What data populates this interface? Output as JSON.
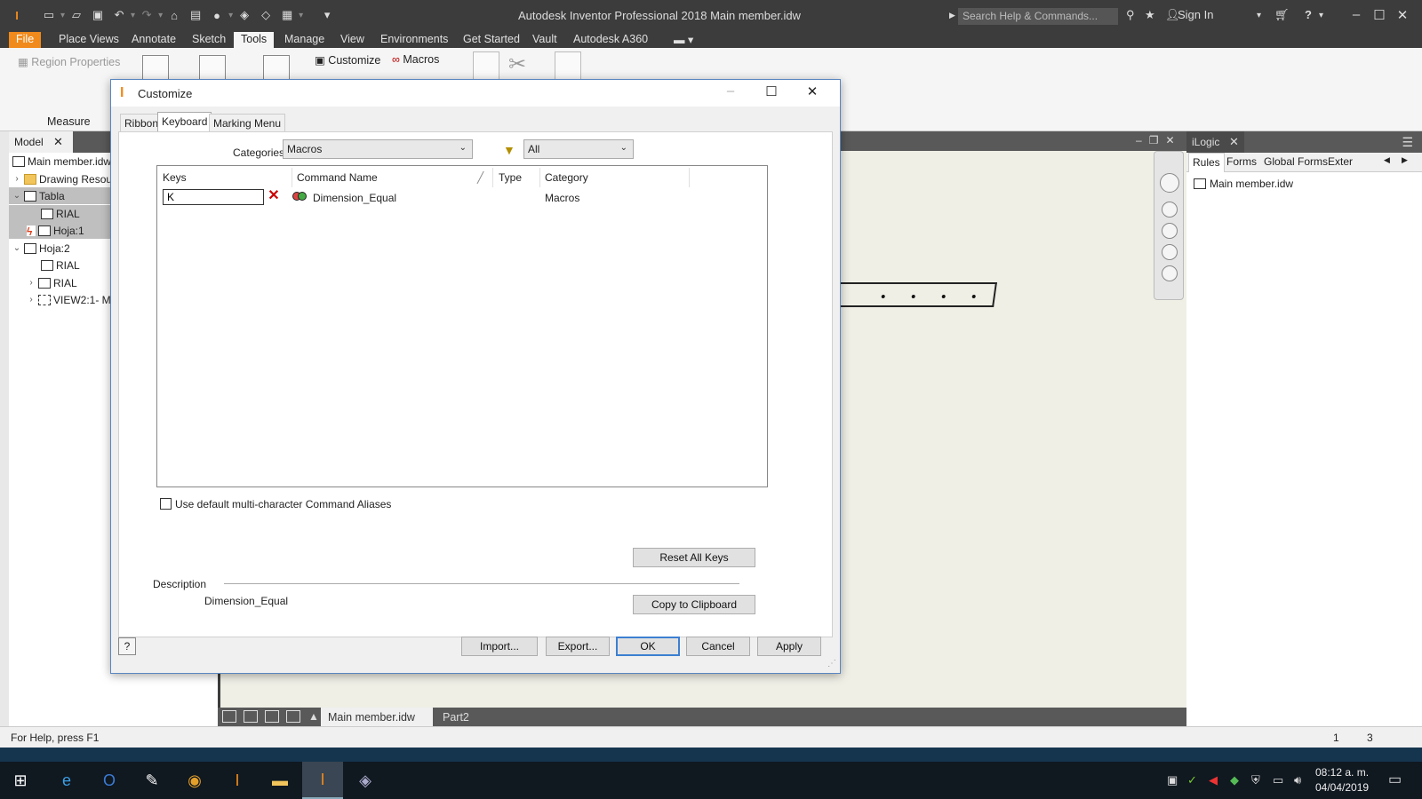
{
  "app": {
    "title": "Autodesk Inventor Professional 2018    Main member.idw",
    "search_placeholder": "Search Help & Commands...",
    "sign_in": "Sign In"
  },
  "ribbon": {
    "tabs": [
      "File",
      "Place Views",
      "Annotate",
      "Sketch",
      "Tools",
      "Manage",
      "View",
      "Environments",
      "Get Started",
      "Vault",
      "Autodesk A360"
    ],
    "active_tab": "Tools",
    "region_properties": "Region Properties",
    "measure_label": "Measure",
    "customize_label": "Customize",
    "macros_label": "Macros"
  },
  "browser": {
    "tab_label": "Model",
    "items": [
      {
        "label": "Main member.idw"
      },
      {
        "label": "Drawing Resour"
      },
      {
        "label": "Tabla"
      },
      {
        "label": "RIAL"
      },
      {
        "label": "Hoja:1"
      },
      {
        "label": "Hoja:2"
      },
      {
        "label": "RIAL"
      },
      {
        "label": "RIAL"
      },
      {
        "label": "VIEW2:1- Ma"
      }
    ]
  },
  "ilogic": {
    "title": "iLogic",
    "tabs": [
      "Rules",
      "Forms",
      "Global Forms",
      "Exter"
    ],
    "active_tab": "Rules",
    "tree_item": "Main member.idw"
  },
  "doc_tabs": [
    {
      "label": "Main member.idw",
      "active": true
    },
    {
      "label": "Part2",
      "active": false
    }
  ],
  "status": {
    "help": "For Help, press F1",
    "count_a": "1",
    "count_b": "3"
  },
  "clock": {
    "time": "08:12 a. m.",
    "date": "04/04/2019"
  },
  "dialog": {
    "title": "Customize",
    "tabs": [
      "Ribbon",
      "Keyboard",
      "Marking Menu"
    ],
    "active_tab": "Keyboard",
    "categories_label": "Categories",
    "categories_value": "Macros",
    "filter_value": "All",
    "columns": [
      "Keys",
      "Command Name",
      "Type",
      "Category"
    ],
    "rows": [
      {
        "keys": "K",
        "command": "Dimension_Equal",
        "type": "",
        "category": "Macros"
      }
    ],
    "checkbox_label": "Use default multi-character Command Aliases",
    "checkbox_checked": false,
    "reset_button": "Reset All Keys",
    "description_label": "Description",
    "description_value": "Dimension_Equal",
    "copy_button": "Copy to Clipboard",
    "import_button": "Import...",
    "export_button": "Export...",
    "ok_button": "OK",
    "cancel_button": "Cancel",
    "apply_button": "Apply"
  },
  "colors": {
    "chrome_dark": "#3c3c3c",
    "file_tab": "#f08a1c",
    "accent_blue": "#3c7fd1"
  }
}
